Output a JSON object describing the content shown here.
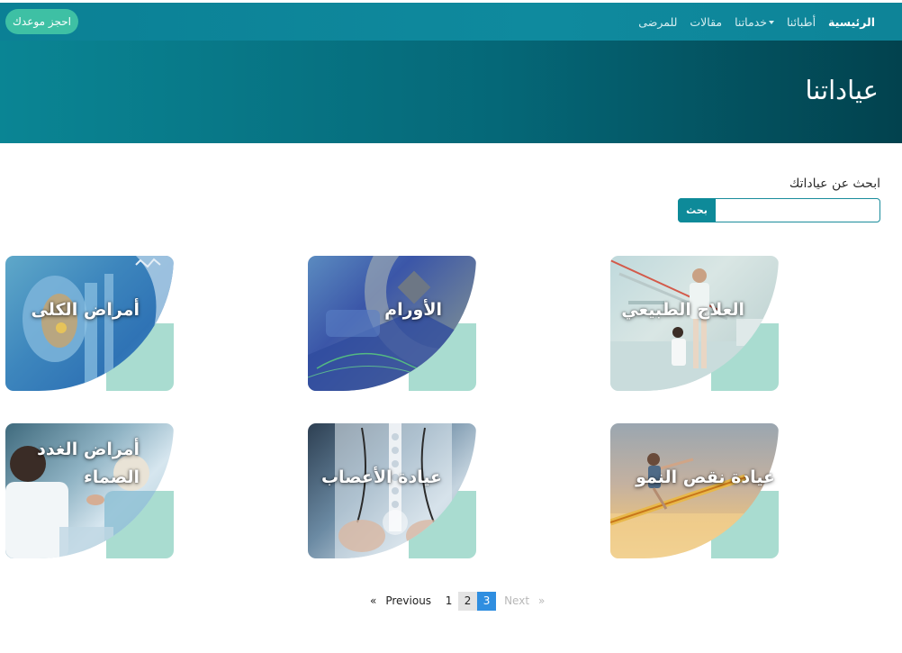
{
  "navbar": {
    "book_button": "احجز موعدك",
    "links": [
      {
        "label": "الرئيسية",
        "active": true
      },
      {
        "label": "أطبائنا",
        "active": false
      },
      {
        "label": "خدماتنا",
        "active": false,
        "dropdown": true
      },
      {
        "label": "مقالات",
        "active": false
      },
      {
        "label": "للمرضى",
        "active": false
      }
    ]
  },
  "hero": {
    "title": "عياداتنا"
  },
  "search": {
    "label": "ابحث عن عياداتك",
    "button": "بحث",
    "value": "",
    "placeholder": ""
  },
  "clinics": [
    {
      "title": "العلاج الطبيعي"
    },
    {
      "title": "الأورام"
    },
    {
      "title": "أمراض الكلى"
    },
    {
      "title": "عيادة نقص النمو"
    },
    {
      "title": "عيادة الأعصاب"
    },
    {
      "title": "أمراض الغدد الصماء"
    }
  ],
  "pagination": {
    "prev_arrow": "«",
    "prev": "Previous",
    "pages": [
      "1",
      "2",
      "3"
    ],
    "current": "3",
    "next": "Next",
    "next_arrow": "»"
  },
  "colors": {
    "brand": "#0e8a99",
    "accent": "#3ec0a4",
    "card_deco": "#a9dcd0",
    "pagination_active": "#2f8ee0"
  }
}
